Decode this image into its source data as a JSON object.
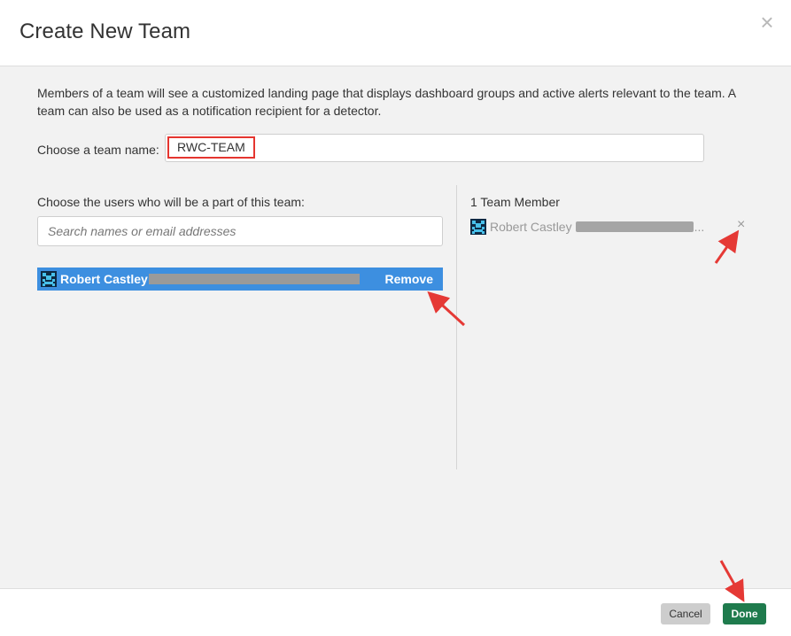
{
  "dialog": {
    "title": "Create New Team",
    "close_glyph": "×"
  },
  "description": "Members of a team will see a customized landing page that displays dashboard groups and active alerts relevant to the team. A team can also be used as a notification recipient for a detector.",
  "team_name": {
    "label": "Choose a team name:",
    "value": "RWC-TEAM"
  },
  "users": {
    "label": "Choose the users who will be a part of this team:",
    "search_placeholder": "Search names or email addresses",
    "selected": [
      {
        "name": "Robert Castley",
        "action_label": "Remove",
        "avatar_icon": "user-avatar-icon"
      }
    ]
  },
  "members": {
    "count_label": "1 Team Member",
    "items": [
      {
        "name": "Robert Castley",
        "ellipsis": "...",
        "remove_glyph": "×",
        "avatar_icon": "user-avatar-icon"
      }
    ]
  },
  "footer": {
    "cancel_label": "Cancel",
    "done_label": "Done"
  },
  "colors": {
    "selected_row": "#3d8fe0",
    "done_button": "#1f7b4d",
    "highlight_border": "#e5352f",
    "annotation_arrow": "#e53935"
  }
}
